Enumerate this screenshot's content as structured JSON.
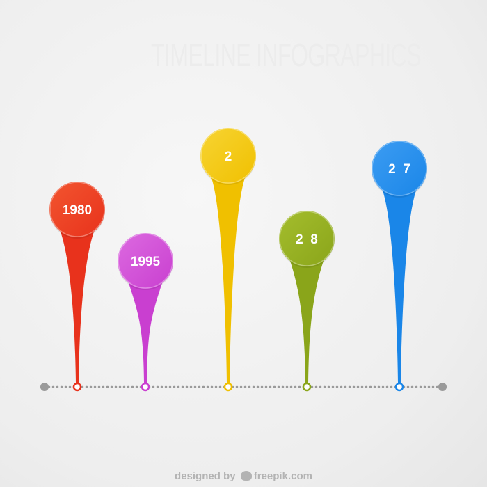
{
  "title": "TIMELINE INFOGRAPHICS",
  "credit": {
    "prefix": "designed by",
    "brand": "freepik.com"
  },
  "timeline": {
    "line_color": "#9a9a9a",
    "milestones": [
      {
        "label": "1980",
        "color": "#e8321c",
        "light": "#f2552f"
      },
      {
        "label": "1995",
        "color": "#c93fd0",
        "light": "#dc6ae0"
      },
      {
        "label": "2",
        "color": "#f0c000",
        "light": "#f7d433"
      },
      {
        "label": "2  8",
        "color": "#8aa51a",
        "light": "#a4bd2d"
      },
      {
        "label": "2  7",
        "color": "#1a86e8",
        "light": "#3c9cf2"
      }
    ]
  }
}
